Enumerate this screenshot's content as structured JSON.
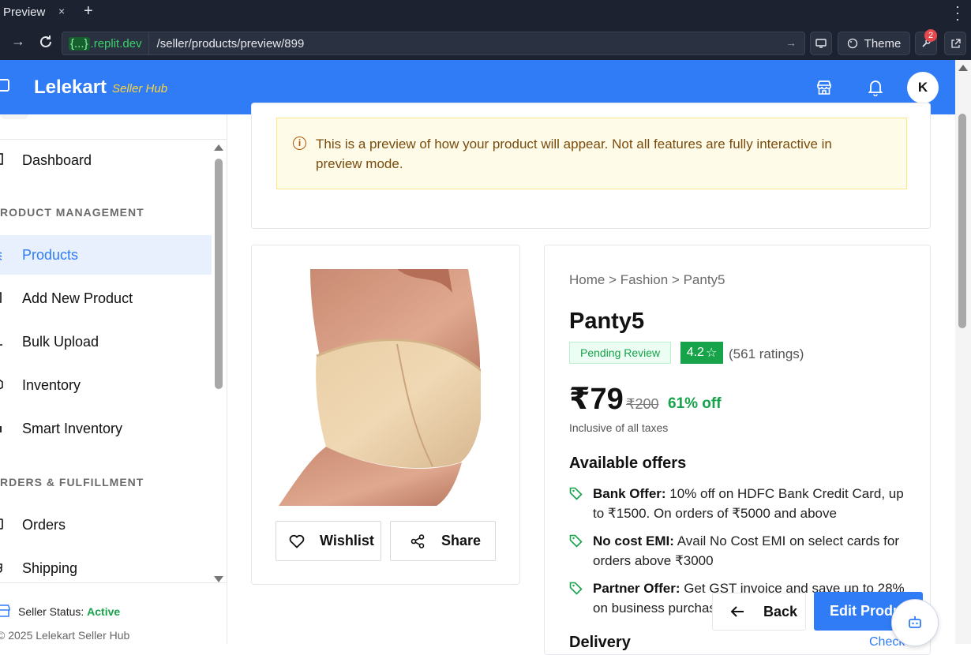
{
  "browser": {
    "tab_title": "Preview",
    "tab_close": "×",
    "new_tab": "+",
    "url_domain_prefix": "{...}",
    "url_domain_suffix": ".replit.dev",
    "url_path": "/seller/products/preview/899",
    "theme_label": "Theme",
    "notification_count": "2"
  },
  "header": {
    "brand": "Lelekart",
    "brand_sub": "Seller Hub",
    "avatar_initial": "K"
  },
  "sidebar": {
    "items": [
      {
        "label": "Dashboard"
      },
      {
        "label": "Products"
      },
      {
        "label": "Add New Product"
      },
      {
        "label": "Bulk Upload"
      },
      {
        "label": "Inventory"
      },
      {
        "label": "Smart Inventory"
      },
      {
        "label": "Orders"
      },
      {
        "label": "Shipping"
      }
    ],
    "sections": {
      "product_management": "RODUCT MANAGEMENT",
      "orders_fulfillment": "RDERS & FULFILLMENT"
    },
    "status_label": "Seller Status:",
    "status_value": "Active",
    "copyright": "© 2025 Lelekart Seller Hub"
  },
  "notice": {
    "text": "This is a preview of how your product will appear. Not all features are fully interactive in preview mode."
  },
  "product": {
    "breadcrumb": "Home > Fashion > Panty5",
    "name": "Panty5",
    "status": "Pending Review",
    "rating": "4.2",
    "rating_star": "☆",
    "ratings_count": "(561 ratings)",
    "price": "₹79",
    "mrp": "₹200",
    "discount": "61% off",
    "tax_note": "Inclusive of all taxes",
    "wishlist_label": "Wishlist",
    "share_label": "Share"
  },
  "offers": {
    "title": "Available offers",
    "items": [
      {
        "title": "Bank Offer:",
        "text": " 10% off on HDFC Bank Credit Card, up to ₹1500. On orders of ₹5000 and above"
      },
      {
        "title": "No cost EMI:",
        "text": " Avail No Cost EMI on select cards for orders above ₹3000"
      },
      {
        "title": "Partner Offer:",
        "text": " Get GST invoice and save up to 28% on business purchases"
      }
    ]
  },
  "delivery": {
    "title": "Delivery",
    "check_label": "Check"
  },
  "actions": {
    "back_label": "Back",
    "edit_label": "Edit Product"
  },
  "colors": {
    "primary": "#2f7cf6",
    "success": "#16a34a",
    "warning_bg": "#fefce8"
  }
}
